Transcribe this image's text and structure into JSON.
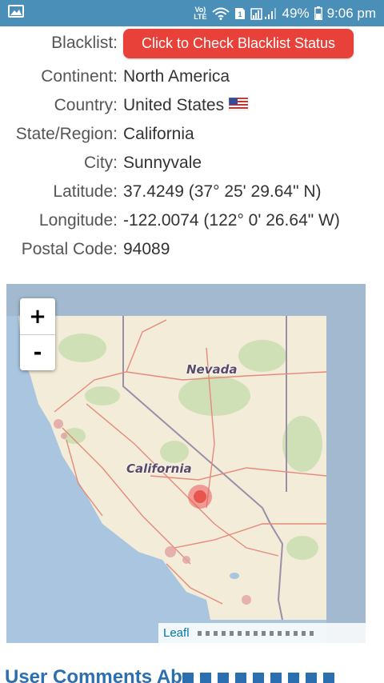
{
  "status_bar": {
    "left_icon": "image-icon",
    "network": "LTE",
    "battery": "49%",
    "time": "9:06 pm",
    "background": "#4a8fb8"
  },
  "info": {
    "blacklist": {
      "label": "Blacklist:",
      "button": "Click to Check Blacklist Status"
    },
    "continent": {
      "label": "Continent:",
      "value": "North America"
    },
    "country": {
      "label": "Country:",
      "value": "United States",
      "flag": "us-flag-icon"
    },
    "state": {
      "label": "State/Region:",
      "value": "California"
    },
    "city": {
      "label": "City:",
      "value": "Sunnyvale"
    },
    "latitude": {
      "label": "Latitude:",
      "value": "37.4249  (37° 25' 29.64\" N)"
    },
    "longitude": {
      "label": "Longitude:",
      "value": "-122.0074  (122° 0' 26.64\" W)"
    },
    "postal": {
      "label": "Postal Code:",
      "value": "94089"
    }
  },
  "map": {
    "zoom_in": "+",
    "zoom_out": "-",
    "labels": {
      "nevada": "Nevada",
      "california": "California"
    },
    "attribution": "Leafl"
  },
  "comments": {
    "heading": "User Comments Ab"
  },
  "colors": {
    "button_red": "#e8413a",
    "link_blue": "#2b6fb0"
  }
}
